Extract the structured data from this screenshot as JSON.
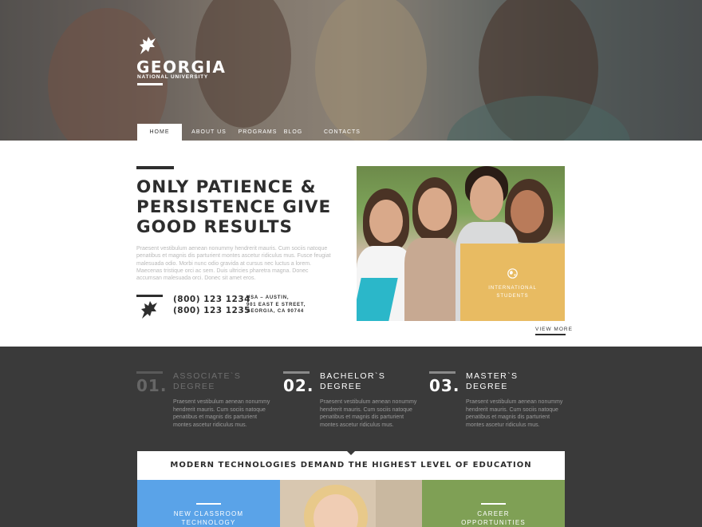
{
  "header": {
    "logo": {
      "title": "GEORGIA",
      "subtitle": "NATIONAL UNIVERSITY"
    },
    "nav": [
      {
        "label": "HOME",
        "active": true
      },
      {
        "label": "ABOUT US",
        "active": false
      },
      {
        "label": "PROGRAMS",
        "active": false
      },
      {
        "label": "BLOG",
        "active": false
      },
      {
        "label": "CONTACTS",
        "active": false
      }
    ]
  },
  "intro": {
    "title_lines": [
      "ONLY PATIENCE &",
      "PERSISTENCE GIVE",
      "GOOD RESULTS"
    ],
    "text": "Praesent vestibulum aenean nonummy hendrerit mauris. Cum sociis natoque penatibus et magnis dis parturient montes ascetur ridiculus mus. Fusce feugiat malesuada odio. Morbi nunc odio gravida at cursus nec luctus a lorem. Maecenas tristique orci ac sem. Duis ultricies pharetra magna. Donec accumsan malesuada orci. Donec sit amet eros.",
    "phones": [
      "(800) 123 1234",
      "(800) 123 1235"
    ],
    "address": [
      "USA – AUSTIN,",
      "901 EAST E STREET,",
      "GEORGIA, CA 90744"
    ],
    "badge_lines": [
      "INTERNATIONAL",
      "STUDENTS"
    ],
    "view_more": "VIEW MORE"
  },
  "degrees": [
    {
      "num": "01.",
      "title_lines": [
        "ASSOCIATE`S",
        "DEGREE"
      ],
      "text": "Praesent vestibulum aenean nonummy hendrerit mauris. Cum sociis natoque penatibus et magnis dis parturient montes ascetur ridiculus mus.",
      "muted": true
    },
    {
      "num": "02.",
      "title_lines": [
        "BACHELOR`S",
        "DEGREE"
      ],
      "text": "Praesent vestibulum aenean nonummy hendrerit mauris. Cum sociis natoque penatibus et magnis dis parturient montes ascetur ridiculus mus.",
      "muted": false
    },
    {
      "num": "03.",
      "title_lines": [
        "MASTER`S",
        "DEGREE"
      ],
      "text": "Praesent vestibulum aenean nonummy hendrerit mauris. Cum sociis natoque penatibus et magnis dis parturient montes ascetur ridiculus mus.",
      "muted": false
    }
  ],
  "tech": {
    "title": "MODERN TECHNOLOGIES DEMAND THE HIGHEST LEVEL OF EDUCATION",
    "tiles": [
      {
        "lines": [
          "NEW CLASSROOM",
          "TECHNOLOGY"
        ],
        "color": "#5aa3e8"
      },
      {
        "lines": [],
        "color": "#d8c7b0"
      },
      {
        "lines": [
          "CAREER",
          "OPPORTUNITIES"
        ],
        "color": "#7fa055"
      }
    ]
  },
  "colors": {
    "accent_yellow": "#e8bb62",
    "dark_bg": "#3a3a3a",
    "blue": "#5aa3e8",
    "green": "#7fa055"
  },
  "icons": [
    "eagle-logo-icon",
    "globe-icon"
  ]
}
